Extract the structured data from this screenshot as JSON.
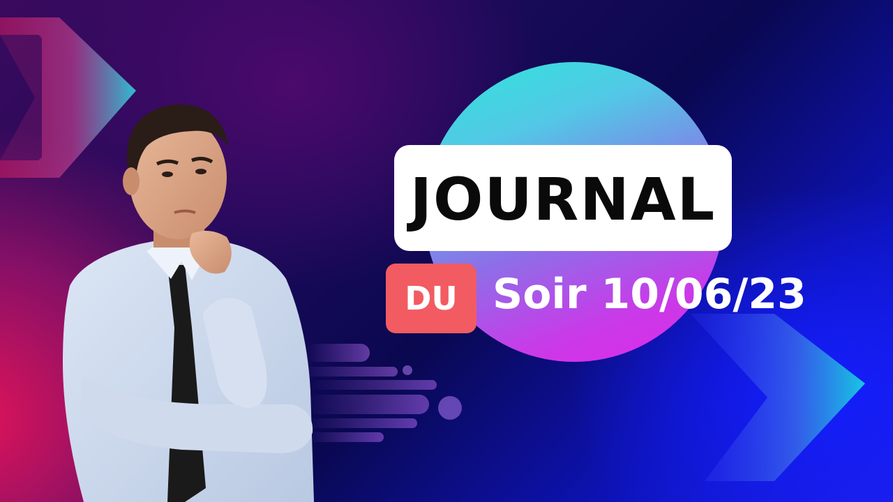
{
  "title": "JOURNAL",
  "badge": "DU",
  "subtitle": "Soir 10/06/23",
  "colors": {
    "title_badge_bg": "#ffffff",
    "du_badge_bg": "#f25b61",
    "title_text": "#0a0a0a",
    "subtitle_text": "#ffffff",
    "circle_top": "#2ee6da",
    "circle_bottom": "#e028ea"
  },
  "illustrations": {
    "person": "thinking-businessman-photo",
    "decor": [
      "chevron-left",
      "chevron-right",
      "speed-lines",
      "gradient-circle"
    ]
  }
}
